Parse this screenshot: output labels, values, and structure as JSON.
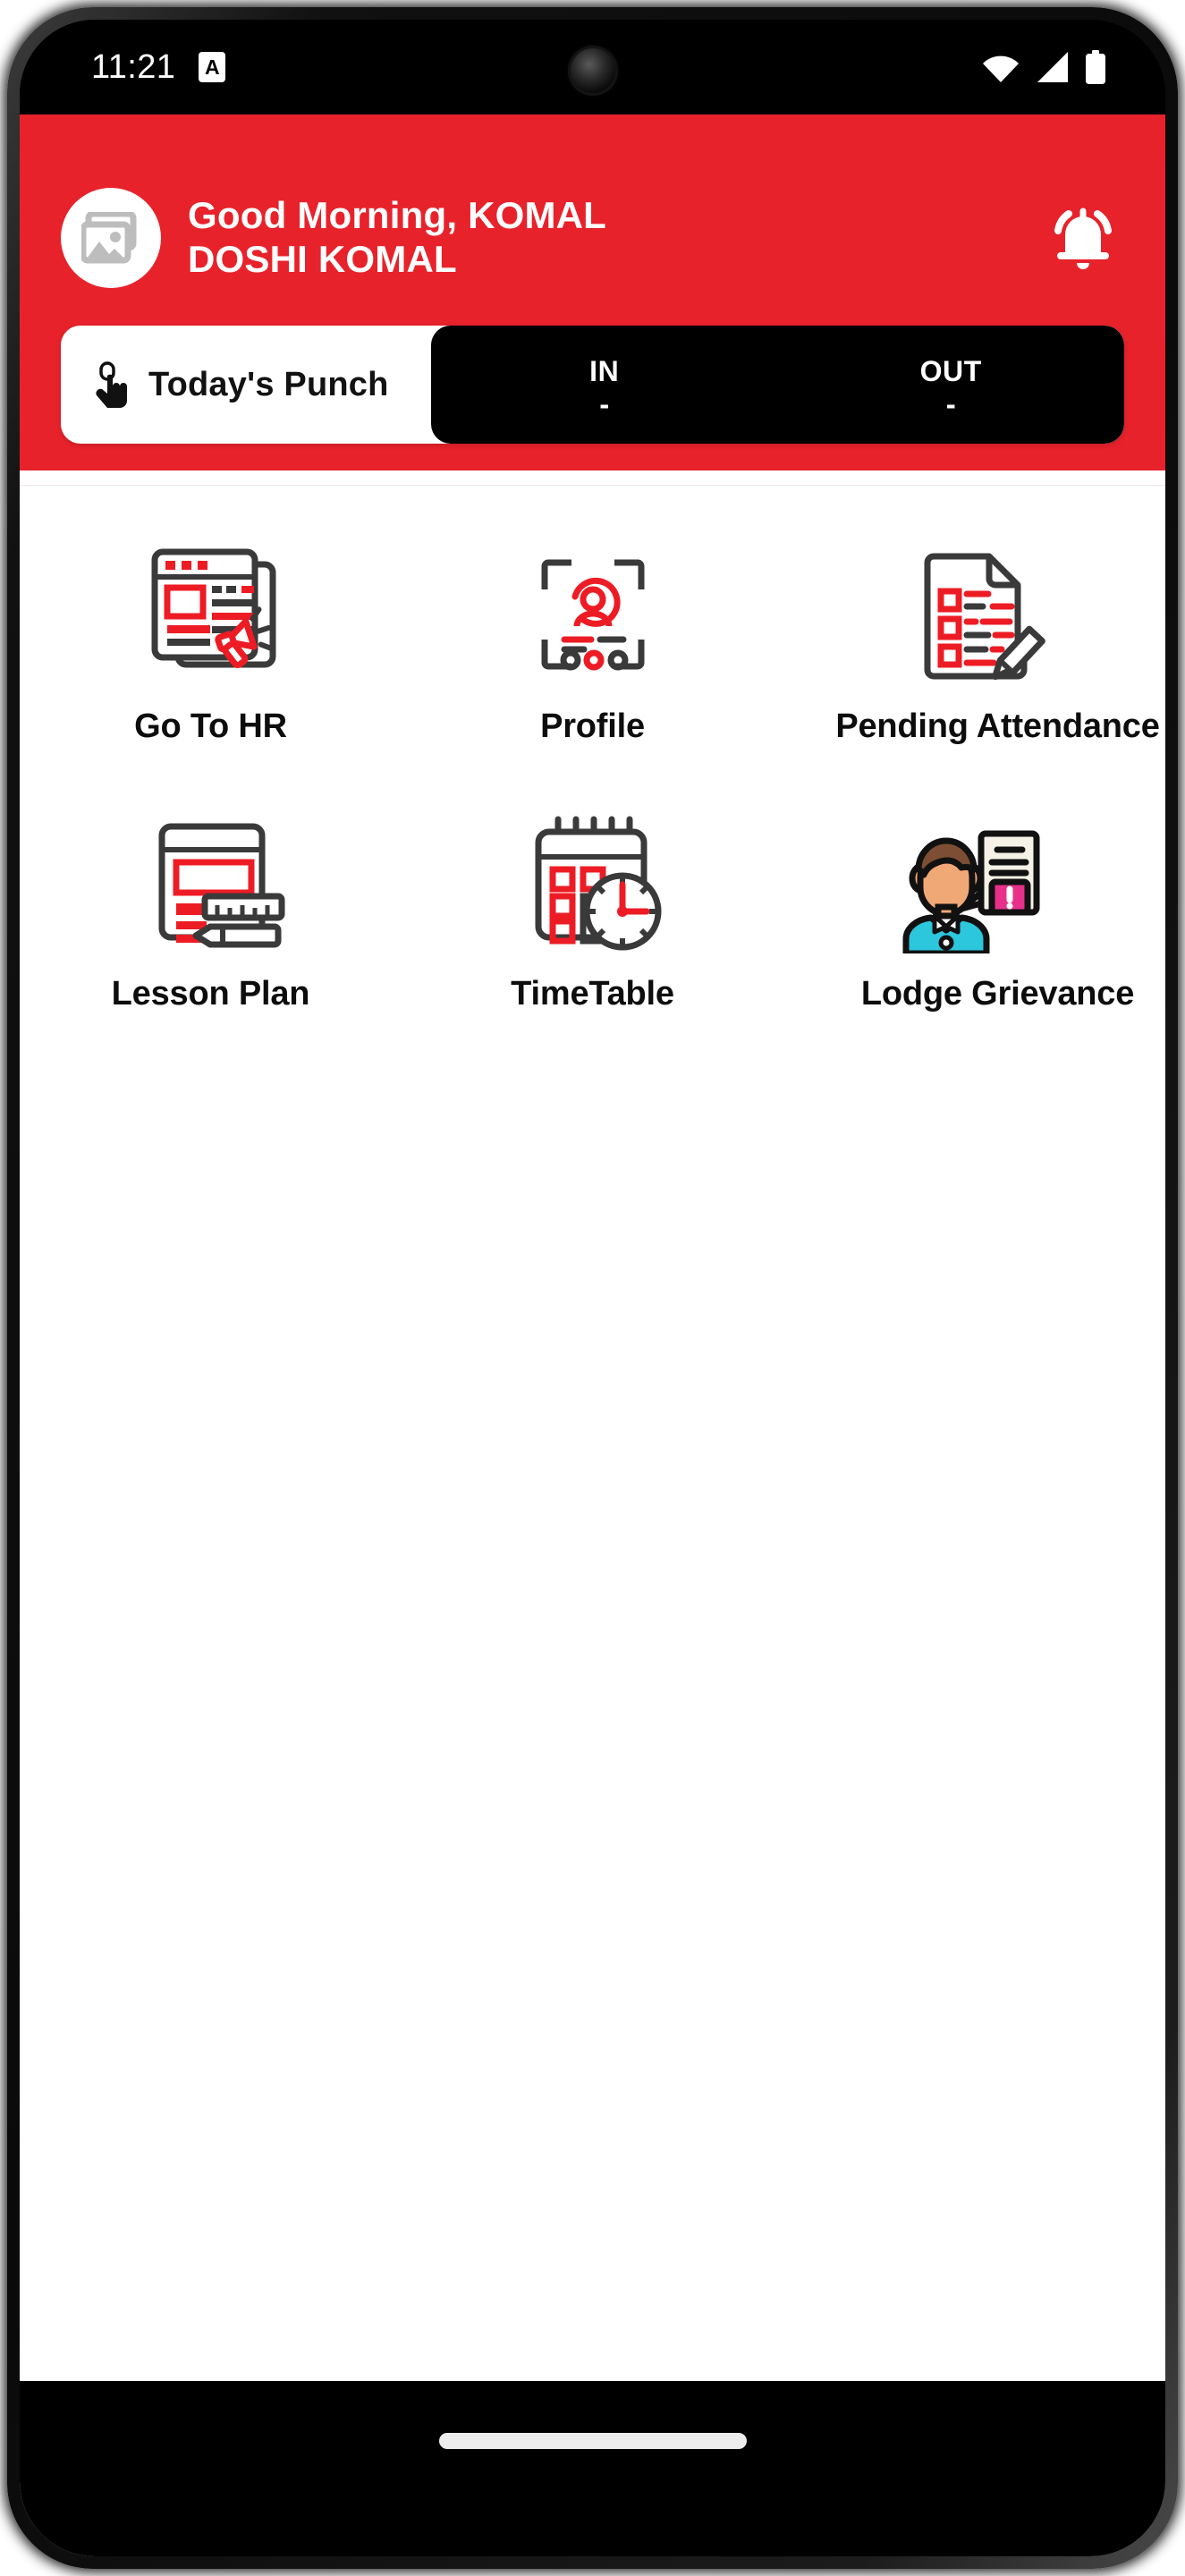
{
  "status_bar": {
    "time": "11:21",
    "notification_badge": "A",
    "icons": [
      "wifi-icon",
      "signal-icon",
      "battery-icon"
    ]
  },
  "header": {
    "background_color": "#e8222b",
    "avatar_icon": "image-placeholder-icon",
    "greeting_line1": "Good Morning, KOMAL",
    "greeting_line2": "DOSHI KOMAL",
    "bell_icon": "notification-bell-icon"
  },
  "punch_card": {
    "touch_icon": "tap-finger-icon",
    "label": "Today's Punch",
    "columns": [
      {
        "label": "IN",
        "value": "-"
      },
      {
        "label": "OUT",
        "value": "-"
      }
    ],
    "panel_color": "#000000"
  },
  "menu": {
    "items": [
      {
        "label": "Go To HR",
        "icon": "hr-announcement-icon"
      },
      {
        "label": "Profile",
        "icon": "profile-card-icon"
      },
      {
        "label": "Pending Attendance",
        "icon": "attendance-checklist-icon"
      },
      {
        "label": "Lesson Plan",
        "icon": "lesson-plan-icon"
      },
      {
        "label": "TimeTable",
        "icon": "calendar-clock-icon"
      },
      {
        "label": "Lodge Grievance",
        "icon": "grievance-person-icon"
      }
    ]
  },
  "system_nav": {
    "gesture_pill": "home-gesture-pill"
  },
  "colors": {
    "brand_red": "#e8222b",
    "icon_red": "#ed1c24",
    "icon_dark": "#3a3a3a",
    "black_panel": "#000000",
    "grievance_skin": "#f0a877",
    "grievance_hair": "#7d4e33",
    "grievance_shirt": "#2cc6dd",
    "grievance_alert": "#e8308a"
  }
}
